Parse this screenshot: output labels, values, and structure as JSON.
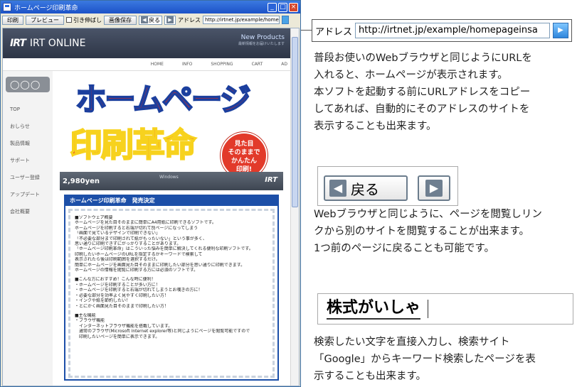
{
  "window": {
    "title": "ホームページ印刷革命",
    "controls": [
      "_",
      "□",
      "×"
    ]
  },
  "toolbar": {
    "print_label": "印刷",
    "preview_label": "プレビュー",
    "shrink_label": "引き伸ばし",
    "save_image_label": "画像保存",
    "back_label": "戻る",
    "address_label": "アドレス",
    "address_value": "http://irtnet.jp/example/homepageinsa"
  },
  "site": {
    "logo": "IRT",
    "name": "IRT ONLINE",
    "promo_title": "New Products",
    "promo_sub": "最新情報をお届けいたします",
    "nav": [
      "HOME",
      "INFO",
      "SHOPPING",
      "CART",
      "AD"
    ],
    "side_logo": "◯◯◯",
    "side_menu": [
      "TOP",
      "おしらせ",
      "製品情報",
      "サポート",
      "ユーザー登録",
      "アップデート",
      "会社概要"
    ],
    "hero_line1": "ホームページ",
    "hero_line2": "印刷革命",
    "badge": [
      "見た目",
      "そのままで",
      "かんたん",
      "印刷!"
    ],
    "price": "2,980yen",
    "os_text": "Windows",
    "brand": "IRT",
    "panel_title": "ホームページ印刷革命　発売決定",
    "panel_lines": [
      "■ソフトウェア概要",
      "ホームページを見た目そのままに簡単にA4用紙に印刷できるソフトです。",
      "ホームページを印刷すると右端が切れて別ページになってしまう",
      "「画面で見ているデザインで印刷できない」",
      "「不必要な部分まで印刷されて紙がもったいない」という事が多く、",
      "思い通りに印刷できずにがっかりすることがあります。",
      "「ホームページ印刷革命」はこういった悩みを簡単に解決してくれる便利な印刷ソフトです。",
      "印刷したいホームページのURLを指定するかキーワードで検索して",
      "表示されたら後は印刷範囲を選択するだけ。",
      "簡単にホームページを画面見た目そのままに印刷したい部分を思い通りに印刷できます。",
      "ホームページの情報を閲覧に印刷する方には必須のソフトです。",
      "",
      "■こんな方におすすめ！こんな時に便利！",
      "・ホームページを印刷することが多い方に！",
      "・ホームページを印刷すると右端が切れてしまうとお嘆きの方に！",
      "・必要な部分を効率よく見やすく印刷したい方！",
      "・インクや紙を節約したい！",
      "・とにかく画面見た目そのままで印刷したい方！",
      "",
      "■主な機能",
      "・ブラウザ機能",
      "　インターネットブラウザ機能を搭載しています。",
      "　通常のブラウザ(Microsoft Internet explorer等)と同じようにページを閲覧可能ですので",
      "　印刷したいページを簡単に表示できます。"
    ]
  },
  "zoom": {
    "address_label": "アドレス",
    "address_value": "http://irtnet.jp/example/homepageinsa",
    "back_label": "戻る",
    "ime_text": "株式がいしゃ"
  },
  "paragraphs": {
    "p1": [
      "普段お使いのWebブラウザと同じようにURLを",
      "入れると、ホームページが表示されます。",
      "本ソフトを起動する前にURLアドレスをコピー",
      "してあれば、自動的にそのアドレスのサイトを",
      "表示することも出来ます。"
    ],
    "p2": [
      "Webブラウザと同じように、ページを閲覧しリン",
      "クから別のサイトを閲覧することが出来ます。",
      "1つ前のページに戻ることも可能です。"
    ],
    "p3": [
      "検索したい文字を直接入力し、検索サイト",
      "「Google」からキーワード検索したページを表",
      "示することも出来ます。"
    ]
  },
  "colors": {
    "title_bar": "#1c52c8",
    "hero_red": "#e82a1c",
    "panel_blue": "#1c4fa8",
    "badge_red": "#e23a2a"
  }
}
